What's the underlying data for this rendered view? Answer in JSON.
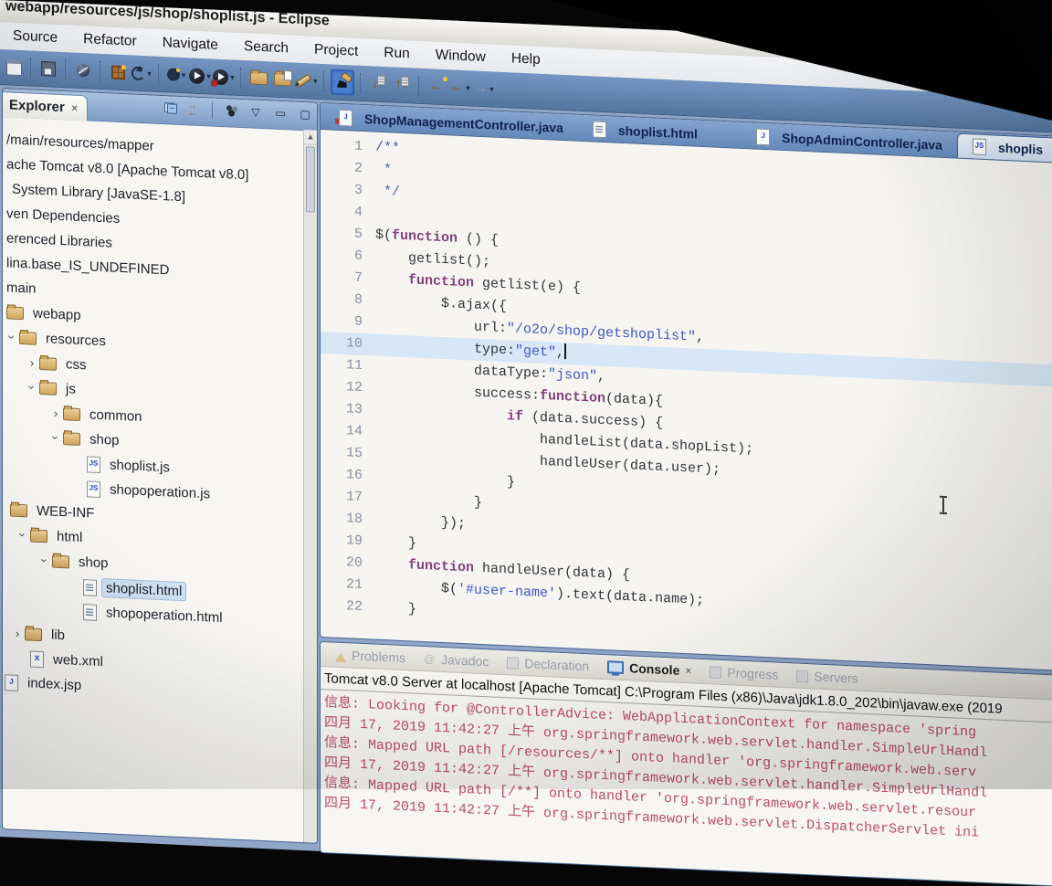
{
  "window": {
    "title": "webapp/resources/js/shop/shoplist.js - Eclipse"
  },
  "menu": {
    "items": [
      "Source",
      "Refactor",
      "Navigate",
      "Search",
      "Project",
      "Run",
      "Window",
      "Help"
    ]
  },
  "toolbar": {
    "icons": [
      {
        "name": "new-window-icon",
        "glyph": "win"
      },
      {
        "sep": true
      },
      {
        "name": "save-icon",
        "glyph": "save"
      },
      {
        "sep": true
      },
      {
        "name": "breakpoint-icon",
        "glyph": "sphere"
      },
      {
        "sep": true
      },
      {
        "name": "new-wizard-icon",
        "glyph": "wizard"
      },
      {
        "name": "refresh-icon",
        "glyph": "refresh",
        "dropdown": true
      },
      {
        "sep": true
      },
      {
        "name": "settings-icon",
        "glyph": "gear",
        "dropdown": true
      },
      {
        "name": "run-icon",
        "glyph": "run",
        "dropdown": true
      },
      {
        "name": "debug-run-icon",
        "glyph": "runred",
        "dropdown": true
      },
      {
        "sep": true
      },
      {
        "name": "open-folder-icon",
        "glyph": "folder"
      },
      {
        "name": "import-folder-icon",
        "glyph": "folderdoc"
      },
      {
        "name": "pen-icon",
        "glyph": "pen",
        "dropdown": true
      },
      {
        "sep": true
      },
      {
        "name": "highlighter-icon",
        "glyph": "marker",
        "active": true
      },
      {
        "sep": true
      },
      {
        "name": "next-annotation-icon",
        "glyph": "down",
        "dropdown": true
      },
      {
        "name": "prev-annotation-icon",
        "glyph": "up",
        "dropdown": true
      },
      {
        "sep": true
      },
      {
        "name": "last-edit-location-icon",
        "glyph": "backstar"
      },
      {
        "name": "back-icon",
        "glyph": "back",
        "dropdown": true
      },
      {
        "name": "forward-icon",
        "glyph": "forward",
        "dropdown": true
      }
    ],
    "dropdown_glyph": "▾"
  },
  "explorer": {
    "tab_label": "Explorer",
    "close_glyph": "×",
    "header_icons": [
      "collapse-all-icon",
      "link-with-editor-icon",
      "view-menu-dots-icon",
      "view-menu-chevron-icon",
      "minimize-icon",
      "maximize-icon"
    ],
    "chevron_glyph": "▽",
    "minimize_glyph": "▭",
    "maximize_glyph": "▢",
    "scroll_up_glyph": "▲",
    "items": [
      {
        "label": "/main/resources/mapper",
        "icon": "none",
        "pad": 0,
        "arrow": ""
      },
      {
        "label": "ache Tomcat v8.0 [Apache Tomcat v8.0]",
        "icon": "none",
        "pad": 0,
        "arrow": ""
      },
      {
        "label": "System Library [JavaSE-1.8]",
        "icon": "none",
        "pad": 6,
        "arrow": ""
      },
      {
        "label": "ven Dependencies",
        "icon": "none",
        "pad": 0,
        "arrow": ""
      },
      {
        "label": "erenced Libraries",
        "icon": "none",
        "pad": 0,
        "arrow": ""
      },
      {
        "label": "lina.base_IS_UNDEFINED",
        "icon": "none",
        "pad": 0,
        "arrow": ""
      },
      {
        "label": "main",
        "icon": "none",
        "pad": 0,
        "arrow": ""
      },
      {
        "label": "webapp",
        "icon": "folder",
        "pad": 4,
        "arrow": ""
      },
      {
        "label": "resources",
        "icon": "folder",
        "pad": 2,
        "arrow": "v"
      },
      {
        "label": "css",
        "icon": "folder",
        "pad": 24,
        "arrow": ">"
      },
      {
        "label": "js",
        "icon": "folder",
        "pad": 24,
        "arrow": "v"
      },
      {
        "label": "common",
        "icon": "folder",
        "pad": 50,
        "arrow": ">"
      },
      {
        "label": "shop",
        "icon": "folder",
        "pad": 50,
        "arrow": "v"
      },
      {
        "label": "shoplist.js",
        "icon": "js",
        "pad": 92,
        "arrow": ""
      },
      {
        "label": "shopoperation.js",
        "icon": "js",
        "pad": 92,
        "arrow": ""
      },
      {
        "label": "WEB-INF",
        "icon": "folder",
        "pad": 8,
        "arrow": ""
      },
      {
        "label": "html",
        "icon": "folder",
        "pad": 14,
        "arrow": "v"
      },
      {
        "label": "shop",
        "icon": "folder",
        "pad": 38,
        "arrow": "v"
      },
      {
        "label": "shoplist.html",
        "icon": "html",
        "pad": 88,
        "arrow": "",
        "selected": true
      },
      {
        "label": "shopoperation.html",
        "icon": "html",
        "pad": 88,
        "arrow": ""
      },
      {
        "label": "lib",
        "icon": "folder",
        "pad": 8,
        "arrow": ">"
      },
      {
        "label": "web.xml",
        "icon": "xml",
        "pad": 30,
        "arrow": ""
      },
      {
        "label": "index.jsp",
        "icon": "jsp",
        "pad": 2,
        "arrow": ""
      }
    ]
  },
  "editor": {
    "tabs": [
      {
        "label": "ShopManagementController.java",
        "icon": "java",
        "error_badge": true,
        "active": false
      },
      {
        "label": "shoplist.html",
        "icon": "html",
        "active": false
      },
      {
        "label": "ShopAdminController.java",
        "icon": "java",
        "active": false
      },
      {
        "label": "shoplis",
        "icon": "js",
        "active": true
      }
    ],
    "current_line": 10,
    "lines": [
      {
        "n": 1,
        "toks": [
          [
            "c",
            "/**"
          ]
        ]
      },
      {
        "n": 2,
        "toks": [
          [
            "c",
            " *"
          ]
        ]
      },
      {
        "n": 3,
        "toks": [
          [
            "c",
            " */"
          ]
        ]
      },
      {
        "n": 4,
        "toks": []
      },
      {
        "n": 5,
        "toks": [
          [
            "p",
            "$("
          ],
          [
            "k",
            "function"
          ],
          [
            "p",
            " () {"
          ]
        ]
      },
      {
        "n": 6,
        "toks": [
          [
            "p",
            "    getlist();"
          ]
        ]
      },
      {
        "n": 7,
        "toks": [
          [
            "p",
            "    "
          ],
          [
            "k",
            "function"
          ],
          [
            "p",
            " getlist(e) {"
          ]
        ]
      },
      {
        "n": 8,
        "toks": [
          [
            "p",
            "        $.ajax({"
          ]
        ]
      },
      {
        "n": 9,
        "toks": [
          [
            "p",
            "            url:"
          ],
          [
            "s",
            "\"/o2o/shop/getshoplist\""
          ],
          [
            "p",
            ","
          ]
        ]
      },
      {
        "n": 10,
        "toks": [
          [
            "p",
            "            type:"
          ],
          [
            "s",
            "\"get\""
          ],
          [
            "p",
            ","
          ],
          [
            "caret",
            ""
          ]
        ]
      },
      {
        "n": 11,
        "toks": [
          [
            "p",
            "            dataType:"
          ],
          [
            "s",
            "\"json\""
          ],
          [
            "p",
            ","
          ]
        ]
      },
      {
        "n": 12,
        "toks": [
          [
            "p",
            "            success:"
          ],
          [
            "k",
            "function"
          ],
          [
            "p",
            "(data){"
          ]
        ]
      },
      {
        "n": 13,
        "toks": [
          [
            "p",
            "                "
          ],
          [
            "k",
            "if"
          ],
          [
            "p",
            " (data.success) {"
          ]
        ]
      },
      {
        "n": 14,
        "toks": [
          [
            "p",
            "                    handleList(data.shopList);"
          ]
        ]
      },
      {
        "n": 15,
        "toks": [
          [
            "p",
            "                    handleUser(data.user);"
          ]
        ]
      },
      {
        "n": 16,
        "toks": [
          [
            "p",
            "                }"
          ]
        ]
      },
      {
        "n": 17,
        "toks": [
          [
            "p",
            "            }"
          ]
        ]
      },
      {
        "n": 18,
        "toks": [
          [
            "p",
            "        });"
          ]
        ]
      },
      {
        "n": 19,
        "toks": [
          [
            "p",
            "    }"
          ]
        ]
      },
      {
        "n": 20,
        "toks": [
          [
            "p",
            "    "
          ],
          [
            "k",
            "function"
          ],
          [
            "p",
            " handleUser(data) {"
          ]
        ]
      },
      {
        "n": 21,
        "toks": [
          [
            "p",
            "        $("
          ],
          [
            "s",
            "'#user-name'"
          ],
          [
            "p",
            ").text(data.name);"
          ]
        ]
      },
      {
        "n": 22,
        "toks": [
          [
            "p",
            "    }"
          ]
        ]
      }
    ]
  },
  "console": {
    "tabs": [
      {
        "label": "Problems",
        "icon": "warn"
      },
      {
        "label": "Javadoc",
        "icon": "at"
      },
      {
        "label": "Declaration",
        "icon": "generic"
      },
      {
        "label": "Console",
        "icon": "console",
        "active": true,
        "closable": true
      },
      {
        "label": "Progress",
        "icon": "generic"
      },
      {
        "label": "Servers",
        "icon": "generic"
      }
    ],
    "close_glyph": "×",
    "title": "Tomcat v8.0 Server at localhost [Apache Tomcat] C:\\Program Files (x86)\\Java\\jdk1.8.0_202\\bin\\javaw.exe (2019",
    "log_color": "#bc4d63",
    "lines": [
      "信息: Looking for @ControllerAdvice: WebApplicationContext for namespace 'spring",
      "四月 17, 2019 11:42:27 上午 org.springframework.web.servlet.handler.SimpleUrlHandl",
      "信息: Mapped URL path [/resources/**] onto handler 'org.springframework.web.serv",
      "四月 17, 2019 11:42:27 上午 org.springframework.web.servlet.handler.SimpleUrlHandl",
      "信息: Mapped URL path [/**] onto handler 'org.springframework.web.servlet.resour",
      "四月 17, 2019 11:42:27 上午 org.springframework.web.servlet.DispatcherServlet ini"
    ]
  }
}
